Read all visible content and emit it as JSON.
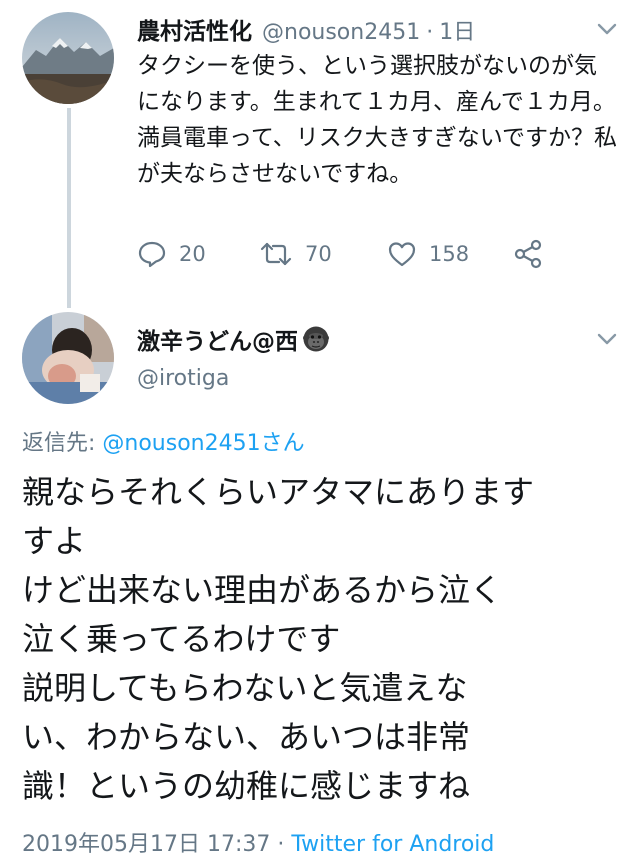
{
  "parent_tweet": {
    "display_name": "農村活性化",
    "handle": "@nouson2451",
    "separator": "·",
    "time": "1日",
    "text": "タクシーを使う、という選択肢がないのが気になります。生まれて１カ月、産んで１カ月。満員電車って、リスク大きすぎないですか？私が夫ならさせないですね。",
    "actions": {
      "reply_count": "20",
      "retweet_count": "70",
      "like_count": "158"
    }
  },
  "reply_tweet": {
    "display_name": "激辛うどん@西",
    "name_emoji": "gorilla-emoji",
    "handle": "@irotiga",
    "reply_to_prefix": "返信先: ",
    "reply_to_mention": "@nouson2451さん",
    "text_lines": [
      "親ならそれくらいアタマにあります",
      "すよ",
      "けど出来ない理由があるから泣く",
      "泣く乗ってるわけです",
      "説明してもらわないと気遣えな",
      "い、わからない、あいつは非常",
      "識！というの幼稚に感じますね"
    ],
    "timestamp": "2019年05月17日 17:37",
    "meta_separator": " · ",
    "source": "Twitter for Android"
  },
  "icons": {
    "reply": "reply-icon",
    "retweet": "retweet-icon",
    "like": "heart-icon",
    "share": "share-icon",
    "menu": "chevron-down-icon"
  },
  "colors": {
    "link": "#1da1f2",
    "secondary_text": "#657786",
    "primary_text": "#14171a",
    "thread_line": "#cdd6dd"
  }
}
